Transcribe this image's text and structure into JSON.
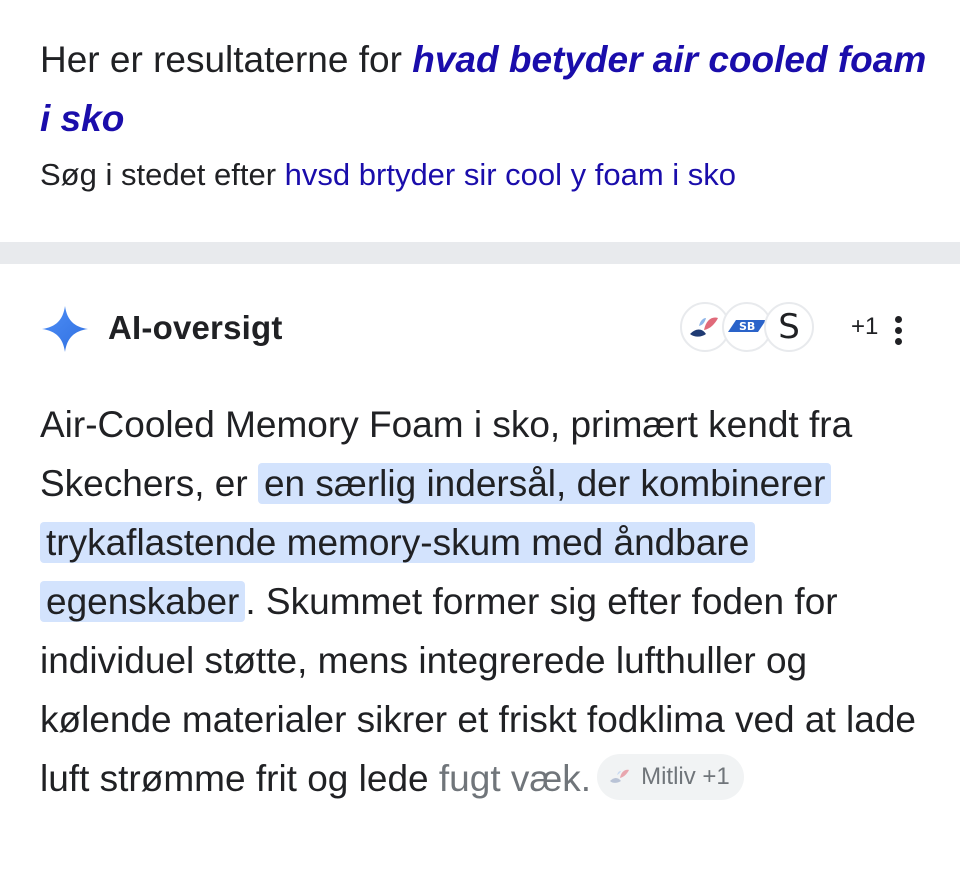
{
  "results": {
    "showing_prefix": "Her er resultaterne for ",
    "query": "hvad betyder air cooled foam i sko",
    "instead_prefix": "Søg i stedet efter ",
    "alt_query": "hvsd brtyder sir cool y foam i sko"
  },
  "ai_overview": {
    "title": "AI-oversigt",
    "sources": [
      {
        "icon": "mitliv-logo-icon"
      },
      {
        "icon": "sb-logo-icon"
      },
      {
        "icon": "s-letter-logo-icon",
        "letter": "S"
      }
    ],
    "more_sources": "+1",
    "menu_icon": "more-vert-icon",
    "body": {
      "text_before": "Air-Cooled Memory Foam i sko, primært kendt fra Skechers, er ",
      "highlight": "en særlig indersål, der kombinerer trykaflastende memory-skum med åndbare egenskaber",
      "text_after": ". Skummet former sig efter foden for individuel støtte, mens integrerede lufthuller og kølende materialer sikrer et friskt fodklima ved at lade luft strømme frit og lede ",
      "text_faded": "fugt væk."
    },
    "source_chip": {
      "icon": "mitliv-logo-icon",
      "label": "Mitliv",
      "count": "+1"
    }
  },
  "colors": {
    "link": "#1a0dab",
    "highlight": "#d3e3fd",
    "divider": "#e8eaed",
    "sparkle_blue": "#4285f4"
  }
}
